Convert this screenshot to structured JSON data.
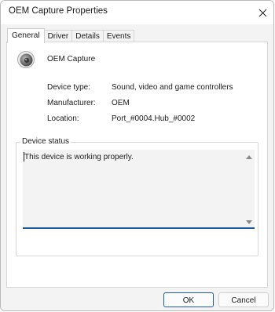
{
  "window": {
    "title": "OEM Capture Properties",
    "close_icon": "close-icon"
  },
  "tabs": [
    {
      "label": "General",
      "active": true
    },
    {
      "label": "Driver",
      "active": false
    },
    {
      "label": "Details",
      "active": false
    },
    {
      "label": "Events",
      "active": false
    }
  ],
  "device": {
    "icon": "speaker-icon",
    "name": "OEM Capture"
  },
  "properties": [
    {
      "label": "Device type:",
      "value": "Sound, video and game controllers"
    },
    {
      "label": "Manufacturer:",
      "value": "OEM"
    },
    {
      "label": "Location:",
      "value": "Port_#0004.Hub_#0002"
    }
  ],
  "status_group": {
    "legend": "Device status",
    "text": "This device is working properly."
  },
  "buttons": {
    "ok": "OK",
    "cancel": "Cancel"
  },
  "colors": {
    "accent": "#1d5aa6",
    "panel_bg": "#ffffff",
    "window_bg": "#f3f3f3"
  }
}
